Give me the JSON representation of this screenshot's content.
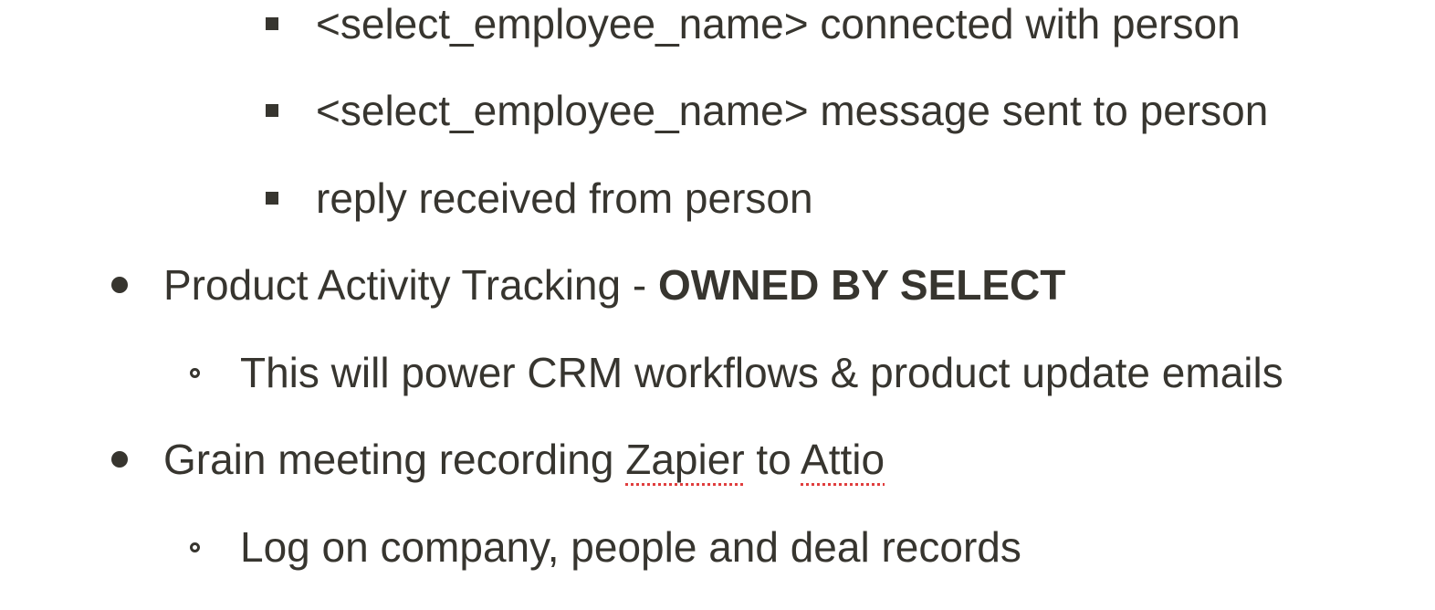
{
  "items": [
    {
      "text": "<select_employee_name> connected with person"
    },
    {
      "text": "<select_employee_name> message sent to person"
    },
    {
      "text": "reply received from person"
    },
    {
      "text_prefix": "Product Activity Tracking - ",
      "text_bold": "OWNED BY SELECT"
    },
    {
      "text": "This will power CRM workflows & product update emails"
    },
    {
      "parts": [
        "Grain meeting recording ",
        "Zapier",
        " to ",
        "Attio"
      ]
    },
    {
      "text": "Log on company, people and deal records"
    }
  ]
}
